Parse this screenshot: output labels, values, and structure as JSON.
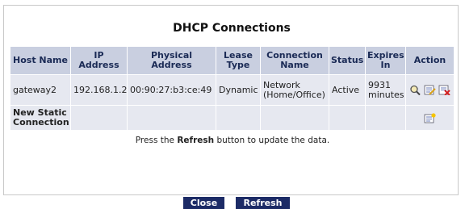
{
  "page": {
    "title": "DHCP Connections"
  },
  "table": {
    "headers": {
      "host_name": "Host Name",
      "ip_address": "IP Address",
      "physical_address": "Physical Address",
      "lease_type": "Lease Type",
      "connection_name": "Connection Name",
      "status": "Status",
      "expires_in": "Expires In",
      "action": "Action"
    },
    "rows": [
      {
        "host_name": "gateway2",
        "ip_address": "192.168.1.2",
        "physical_address": "00:90:27:b3:ce:49",
        "lease_type": "Dynamic",
        "connection_name": "Network (Home/Office)",
        "status": "Active",
        "expires_in": "9931 minutes",
        "actions": [
          "magnifier-icon",
          "edit-icon",
          "delete-icon"
        ]
      }
    ],
    "new_static_connection": "New Static Connection",
    "new_static_action_icon": "new-entry-icon"
  },
  "note": {
    "prefix": "Press the ",
    "keyword": "Refresh",
    "suffix": " button to update the data."
  },
  "buttons": {
    "close": "Close",
    "refresh": "Refresh"
  },
  "colors": {
    "header_bg": "#c9cfe0",
    "cell_bg": "#e6e8f0",
    "button_bg": "#1c2b66",
    "status_active": "#2e8b3c",
    "link": "#2b3f8a"
  }
}
